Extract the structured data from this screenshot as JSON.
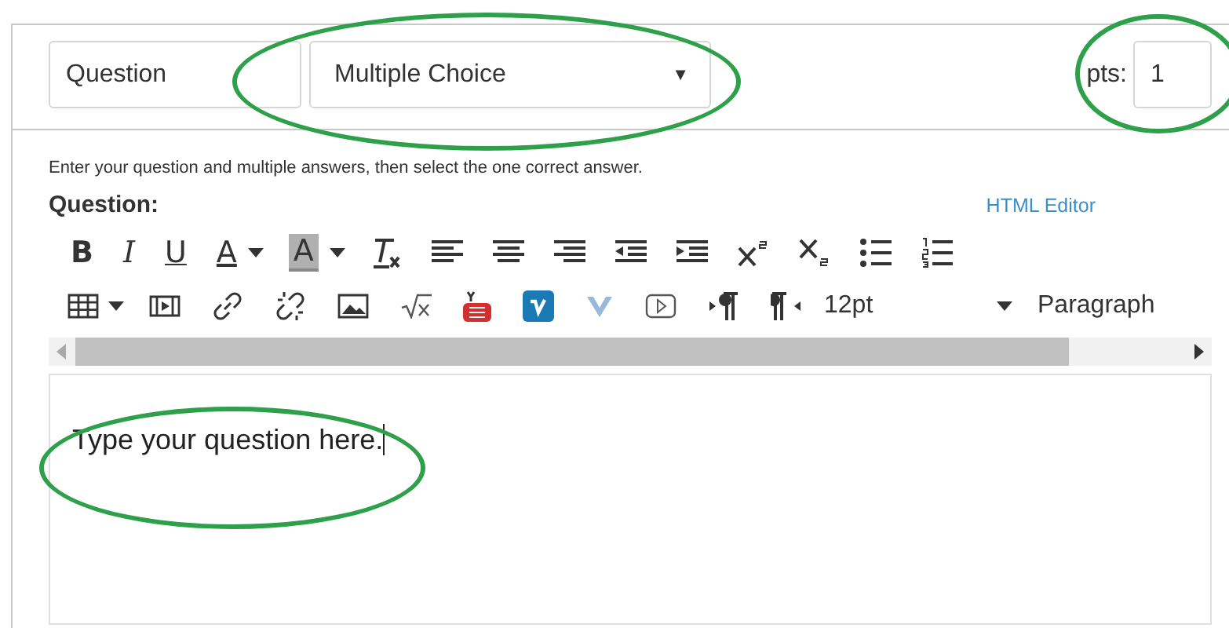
{
  "header": {
    "title_field": {
      "value": "Question"
    },
    "type_select": {
      "value": "Multiple Choice",
      "caret": "▼"
    },
    "points": {
      "label": "pts:",
      "value": "1"
    }
  },
  "instructions": "Enter your question and multiple answers, then select the one correct answer.",
  "question_label": "Question:",
  "html_editor_link": "HTML Editor",
  "toolbar": {
    "bold": "B",
    "italic": "I",
    "underline": "U",
    "text_color": "A",
    "background_color": "A",
    "font_size": "12pt",
    "format": "Paragraph"
  },
  "editor": {
    "value": "Type your question here."
  },
  "annotations": [
    {
      "kind": "ellipse",
      "color": "#2ea04a"
    },
    {
      "kind": "ellipse",
      "color": "#2ea04a"
    },
    {
      "kind": "ellipse",
      "color": "#2ea04a"
    }
  ]
}
